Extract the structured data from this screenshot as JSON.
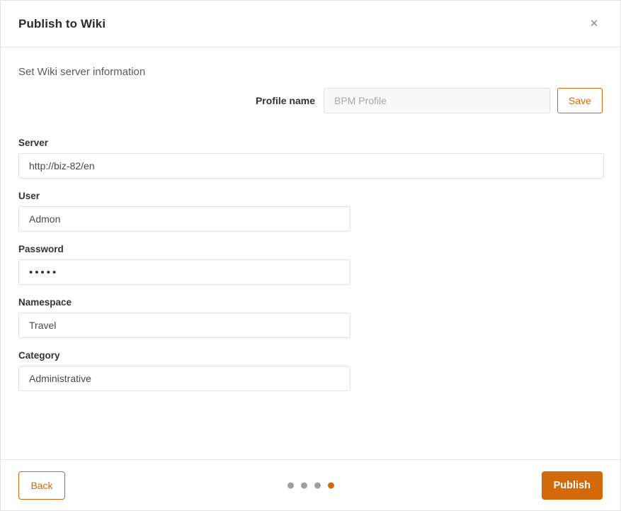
{
  "dialog": {
    "title": "Publish to Wiki",
    "close_icon": "close-icon",
    "close_glyph": "×"
  },
  "body": {
    "section_heading": "Set Wiki server information",
    "profile": {
      "label": "Profile name",
      "value": "",
      "placeholder": "BPM Profile",
      "save_label": "Save"
    },
    "fields": [
      {
        "label": "Server",
        "value": "http://biz-82/en",
        "type": "text",
        "width": "wide"
      },
      {
        "label": "User",
        "value": "Admon",
        "type": "text",
        "width": "narrow"
      },
      {
        "label": "Password",
        "value": "•••••",
        "type": "password",
        "width": "narrow"
      },
      {
        "label": "Namespace",
        "value": "Travel",
        "type": "text",
        "width": "narrow"
      },
      {
        "label": "Category",
        "value": "Administrative",
        "type": "text",
        "width": "narrow"
      }
    ]
  },
  "footer": {
    "back_label": "Back",
    "publish_label": "Publish",
    "steps": {
      "total": 4,
      "active_index": 3
    }
  },
  "colors": {
    "accent": "#d2690a",
    "text": "#333333",
    "muted": "#5a5a5a",
    "placeholder": "#a6a6a6",
    "border": "#e0e0e0",
    "divider": "#e7e7e7",
    "dot_inactive": "#9e9e9e"
  }
}
